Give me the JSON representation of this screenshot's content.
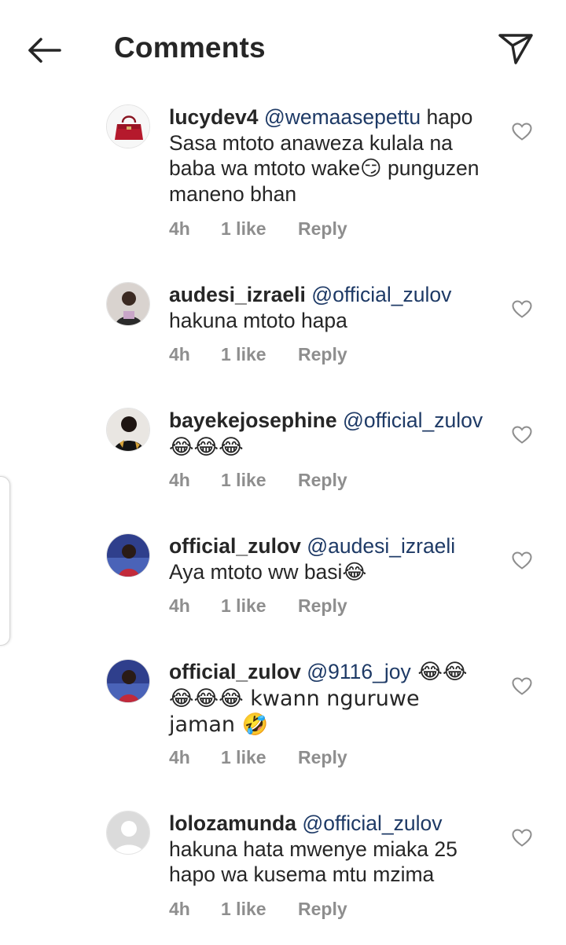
{
  "header": {
    "title": "Comments",
    "back_icon": "arrow-left-icon",
    "share_icon": "paper-plane-icon"
  },
  "colors": {
    "text": "#262626",
    "mention": "#1e3a66",
    "meta": "#8e8e8e",
    "background": "#ffffff"
  },
  "comments": [
    {
      "username": "lucydev4",
      "mention": "@wemaasepettu",
      "text": " hapo Sasa mtoto anaweza kulala na baba wa mtoto wake😏 punguzen maneno bhan",
      "time": "4h",
      "likes": "1 like",
      "reply": "Reply",
      "avatar": "red-handbag"
    },
    {
      "username": "audesi_izraeli",
      "mention": "@official_zulov",
      "text": " hakuna mtoto hapa",
      "time": "4h",
      "likes": "1 like",
      "reply": "Reply",
      "avatar": "person-photo"
    },
    {
      "username": "bayekejosephine",
      "mention": "@official_zulov",
      "text": " 😂😂😂",
      "time": "4h",
      "likes": "1 like",
      "reply": "Reply",
      "avatar": "person-photo"
    },
    {
      "username": "official_zulov",
      "mention": "@audesi_izraeli",
      "text": " Aya mtoto ww basi😂",
      "time": "4h",
      "likes": "1 like",
      "reply": "Reply",
      "avatar": "person-photo"
    },
    {
      "username": "official_zulov",
      "mention": "@9116_joy",
      "text": " 😂😂 😂😂😂 kwann nguruwe jaman 🤣",
      "time": "4h",
      "likes": "1 like",
      "reply": "Reply",
      "avatar": "person-photo"
    },
    {
      "username": "lolozamunda",
      "mention": "@official_zulov",
      "text": " hakuna hata mwenye miaka 25 hapo wa kusema mtu mzima",
      "time": "4h",
      "likes": "1 like",
      "reply": "Reply",
      "avatar": "default-avatar"
    }
  ]
}
